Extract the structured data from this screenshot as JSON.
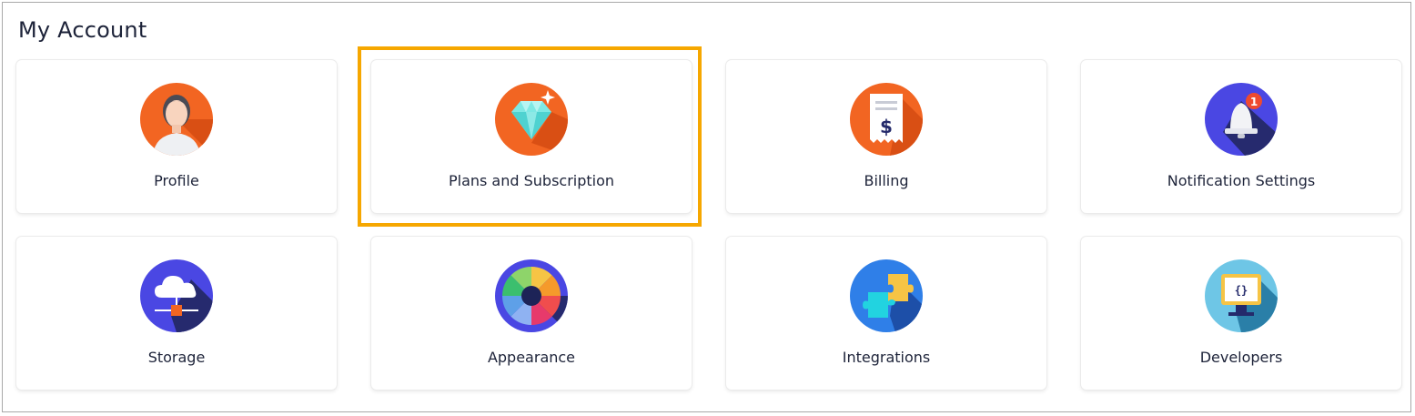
{
  "page": {
    "title": "My Account"
  },
  "colors": {
    "highlight": "#f6a700",
    "orange": "#f26522",
    "indigo": "#4a47e3",
    "navy": "#242a6b"
  },
  "tiles": [
    {
      "label": "Profile",
      "icon": "profile-avatar-icon"
    },
    {
      "label": "Plans and Subscription",
      "icon": "diamond-icon",
      "highlighted": true
    },
    {
      "label": "Billing",
      "icon": "receipt-dollar-icon"
    },
    {
      "label": "Notification Settings",
      "icon": "bell-notification-icon",
      "badge": "1"
    },
    {
      "label": "Storage",
      "icon": "cloud-storage-icon"
    },
    {
      "label": "Appearance",
      "icon": "color-wheel-icon"
    },
    {
      "label": "Integrations",
      "icon": "puzzle-icon"
    },
    {
      "label": "Developers",
      "icon": "code-monitor-icon"
    }
  ]
}
